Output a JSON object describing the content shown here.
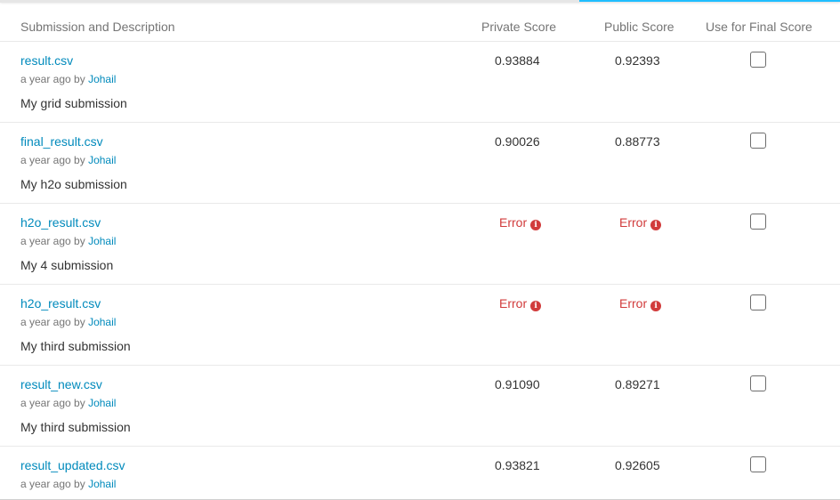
{
  "header": {
    "col_description": "Submission and Description",
    "col_private": "Private Score",
    "col_public": "Public Score",
    "col_final": "Use for Final Score"
  },
  "submissions": [
    {
      "file": "result.csv",
      "time": "a year ago by",
      "user": "Johail",
      "description": "My grid submission",
      "private_score": "0.93884",
      "public_score": "0.92393",
      "use_for_final": false
    },
    {
      "file": "final_result.csv",
      "time": "a year ago by",
      "user": "Johail",
      "description": "My h2o submission",
      "private_score": "0.90026",
      "public_score": "0.88773",
      "use_for_final": false
    },
    {
      "file": "h2o_result.csv",
      "time": "a year ago by",
      "user": "Johail",
      "description": "My 4 submission",
      "private_score": "Error",
      "public_score": "Error",
      "use_for_final": false
    },
    {
      "file": "h2o_result.csv",
      "time": "a year ago by",
      "user": "Johail",
      "description": "My third submission",
      "private_score": "Error",
      "public_score": "Error",
      "use_for_final": false
    },
    {
      "file": "result_new.csv",
      "time": "a year ago by",
      "user": "Johail",
      "description": "My third submission",
      "private_score": "0.91090",
      "public_score": "0.89271",
      "use_for_final": false
    },
    {
      "file": "result_updated.csv",
      "time": "a year ago by",
      "user": "Johail",
      "description": "",
      "private_score": "0.93821",
      "public_score": "0.92605",
      "use_for_final": false
    }
  ],
  "icons": {
    "error_info": "info-circle-icon"
  },
  "colors": {
    "link": "#008abc",
    "error": "#d13b3b",
    "accent": "#20beff"
  }
}
